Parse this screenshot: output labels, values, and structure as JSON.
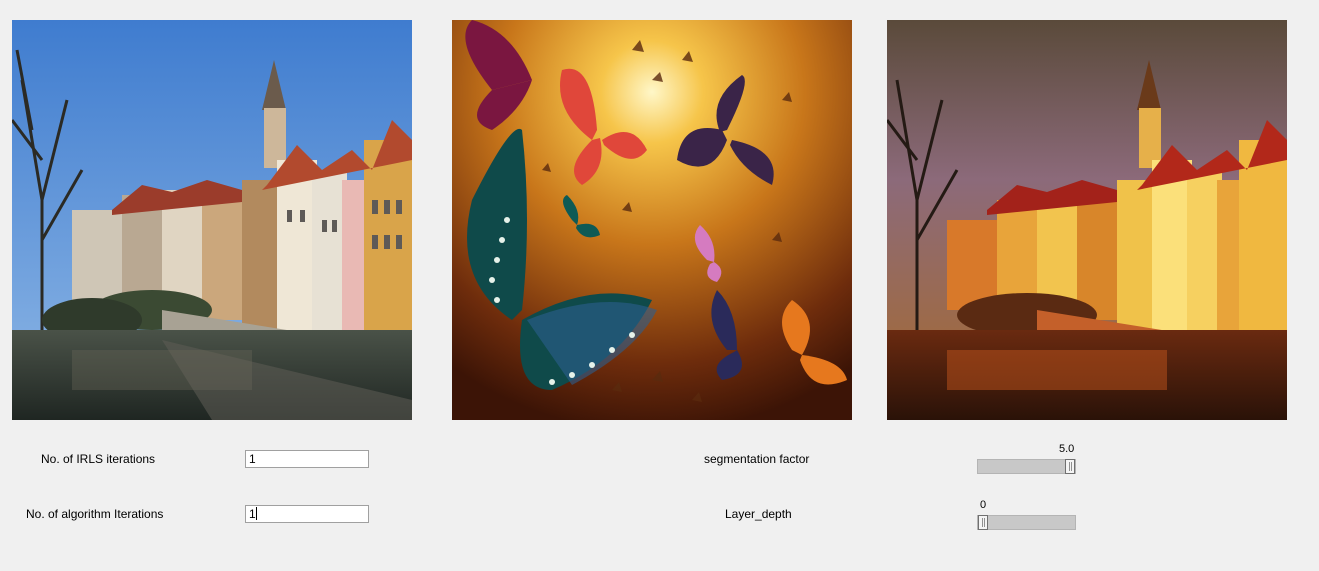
{
  "images": {
    "content": {
      "name": "content-image",
      "alt": ""
    },
    "style": {
      "name": "style-image",
      "alt": ""
    },
    "result": {
      "name": "result-image",
      "alt": ""
    }
  },
  "controls": {
    "irls_label": "No. of IRLS iterations",
    "irls_value": "1",
    "algo_label": "No. of algorithm Iterations",
    "algo_value": "1",
    "seg_label": "segmentation factor",
    "seg_value": "5.0",
    "seg_fraction": 1.0,
    "layer_label": "Layer_depth",
    "layer_value": "0",
    "layer_fraction": 0.0
  },
  "colors": {
    "window_bg": "#f0f0f0",
    "trough": "#c8c8c8"
  }
}
